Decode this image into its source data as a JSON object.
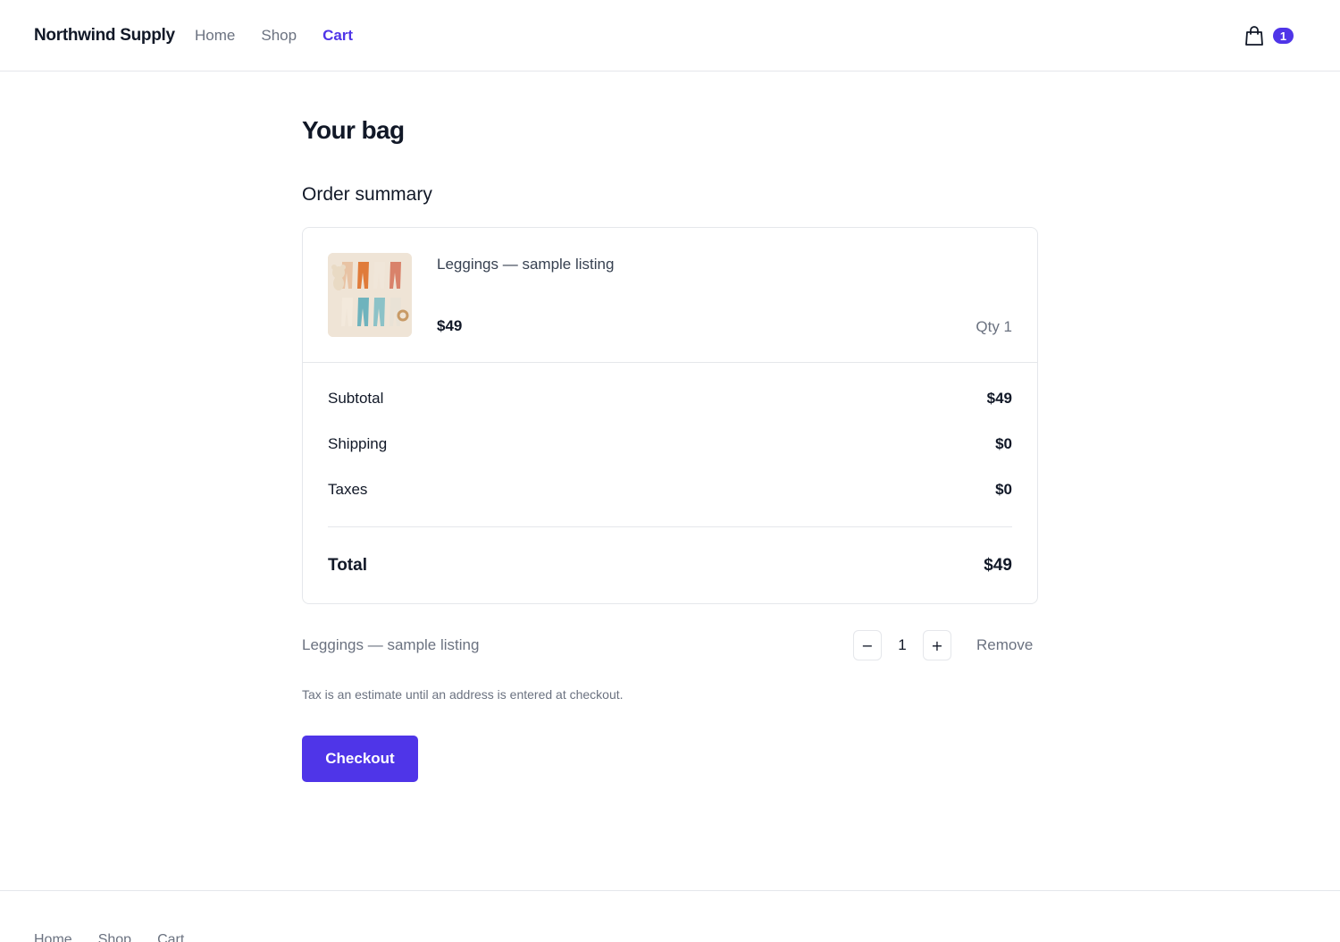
{
  "header": {
    "brand": "Northwind Supply",
    "nav": [
      "Home",
      "Shop",
      "Cart"
    ],
    "active_nav": "Cart",
    "cart_count": "1"
  },
  "main": {
    "page_title": "Your bag",
    "summary_title": "Order summary",
    "item": {
      "name": "Leggings — sample listing",
      "price": "$49",
      "qty_label": "Qty 1"
    },
    "totals": {
      "subtotal_label": "Subtotal",
      "subtotal_value": "$49",
      "shipping_label": "Shipping",
      "shipping_value": "$0",
      "taxes_label": "Taxes",
      "taxes_value": "$0",
      "total_label": "Total",
      "total_value": "$49"
    },
    "qty_row": {
      "name": "Leggings — sample listing",
      "minus": "−",
      "qty": "1",
      "plus": "+",
      "remove": "Remove"
    },
    "note": "Tax is an estimate until an address is entered at checkout.",
    "checkout_label": "Checkout"
  },
  "footer": {
    "nav": [
      "Home",
      "Shop",
      "Cart"
    ]
  },
  "colors": {
    "accent": "#4f35e8",
    "text": "#111827",
    "muted": "#6b7280",
    "border": "#e5e7eb"
  },
  "icons": {
    "cart": "shopping-bag-icon",
    "product_image": "leggings-product-image"
  }
}
